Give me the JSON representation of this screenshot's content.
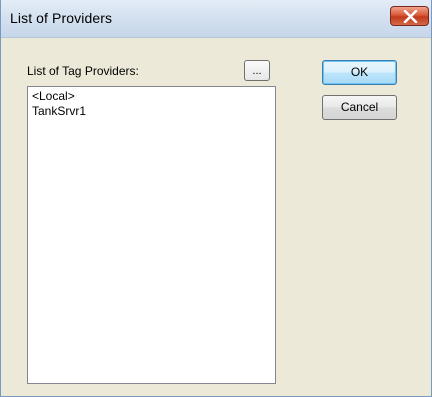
{
  "window": {
    "title": "List of Providers"
  },
  "icons": {
    "close": "close-icon"
  },
  "form": {
    "list_label": "List of Tag Providers:",
    "browse_label": "...",
    "providers": [
      "<Local>",
      "TankSrvr1"
    ]
  },
  "buttons": {
    "ok_label": "OK",
    "cancel_label": "Cancel"
  }
}
